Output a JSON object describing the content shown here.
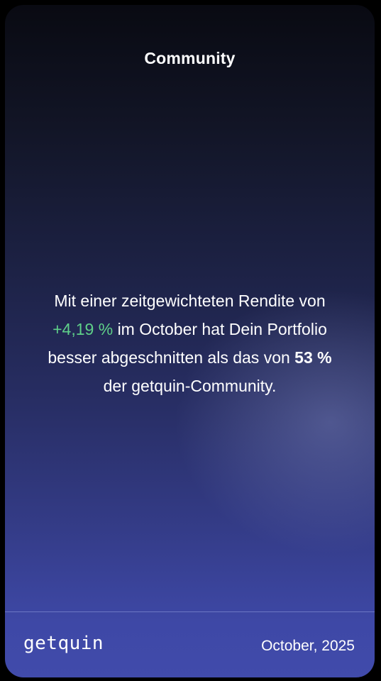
{
  "header": {
    "title": "Community"
  },
  "message": {
    "prefix": "Mit einer zeitgewichteten Rendite von",
    "return_value": "+4,19 %",
    "middle": "im October hat Dein Portfolio besser abgeschnitten als das von",
    "percentile": "53 %",
    "suffix": "der getquin-Community."
  },
  "footer": {
    "brand": "getquin",
    "date": "October, 2025"
  },
  "colors": {
    "positive_return": "#5fd089",
    "background_top": "#090a12",
    "background_bottom": "#414bab"
  }
}
